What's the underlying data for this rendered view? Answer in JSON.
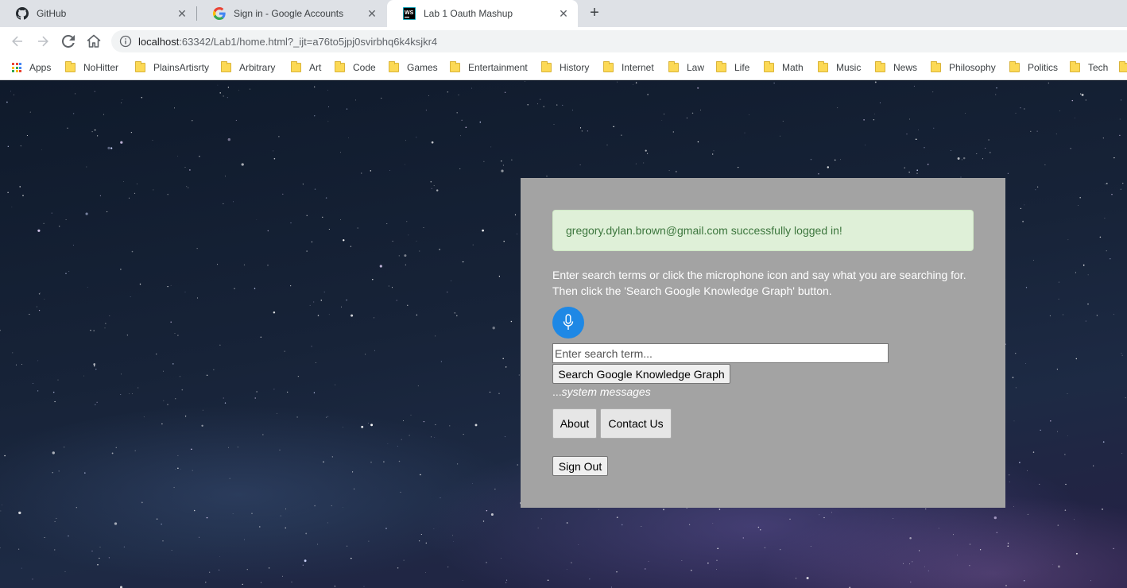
{
  "browser": {
    "tabs": [
      {
        "title": "GitHub",
        "icon": "github-icon",
        "active": false
      },
      {
        "title": "Sign in - Google Accounts",
        "icon": "google-icon",
        "active": false
      },
      {
        "title": "Lab 1 Oauth Mashup",
        "icon": "webstorm-icon",
        "active": true
      }
    ],
    "close_glyph": "✕",
    "new_tab_glyph": "+",
    "url_host": "localhost",
    "url_rest": ":63342/Lab1/home.html?_ijt=a76to5jpj0svirbhq6k4ksjkr4",
    "bookmarks": [
      "Apps",
      "NoHitter",
      "PlainsArtisrty",
      "Arbitrary",
      "Art",
      "Code",
      "Games",
      "Entertainment",
      "History",
      "Internet",
      "Law",
      "Life",
      "Math",
      "Music",
      "News",
      "Philosophy",
      "Politics",
      "Tech"
    ]
  },
  "colors": {
    "panel_bg": "#a3a3a3",
    "alert_bg": "#dff0d8",
    "alert_text": "#3c763d",
    "mic_blue": "#1e88e5",
    "bookmark_folder": "#fcd955"
  },
  "main": {
    "login_message": "gregory.dylan.brown@gmail.com successfully logged in!",
    "instructions": "Enter search terms or click the microphone icon and say what you are searching for. Then click the 'Search Google Knowledge Graph' button.",
    "mic_icon": "microphone-icon",
    "search_placeholder": "Enter search term...",
    "search_button": "Search Google Knowledge Graph",
    "system_messages_prefix": "...",
    "system_messages": "system messages",
    "about_button": "About",
    "contact_button": "Contact Us",
    "signout_button": "Sign Out"
  }
}
